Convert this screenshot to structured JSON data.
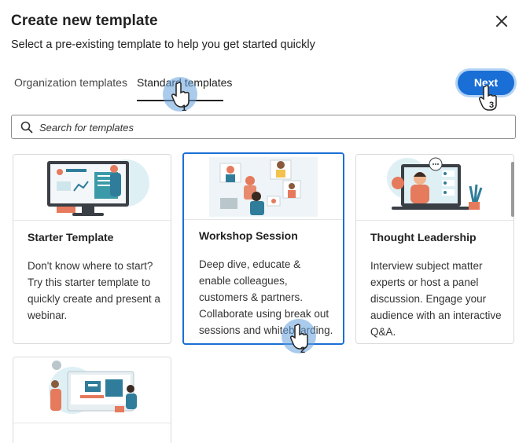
{
  "dialog": {
    "title": "Create new template",
    "subtitle": "Select a pre-existing template to help you get started quickly",
    "close_icon": "close-icon"
  },
  "tabs": [
    {
      "label": "Organization templates",
      "active": false
    },
    {
      "label": "Standard templates",
      "active": true
    }
  ],
  "next_button": {
    "label": "Next"
  },
  "search": {
    "placeholder": "Search for templates",
    "value": "",
    "icon": "search-icon"
  },
  "templates": [
    {
      "name": "Starter Template",
      "description": "Don't know where to start? Try this starter template to quickly create and present a webinar.",
      "selected": false
    },
    {
      "name": "Workshop Session",
      "description": "Deep dive, educate & enable colleagues, customers & partners. Collaborate using break out sessions and whiteboarding.",
      "selected": true
    },
    {
      "name": "Thought Leadership",
      "description": "Interview subject matter experts or host a panel discussion. Engage your audience with an interactive Q&A.",
      "selected": false
    },
    {
      "name": "",
      "description": "",
      "selected": false
    }
  ],
  "annotations": [
    {
      "step": "1",
      "target": "Standard templates tab"
    },
    {
      "step": "2",
      "target": "Workshop Session card"
    },
    {
      "step": "3",
      "target": "Next button"
    }
  ],
  "colors": {
    "accent": "#1a6fd6",
    "selected_border": "#1b6fd5",
    "halo": "#64a0dc"
  }
}
